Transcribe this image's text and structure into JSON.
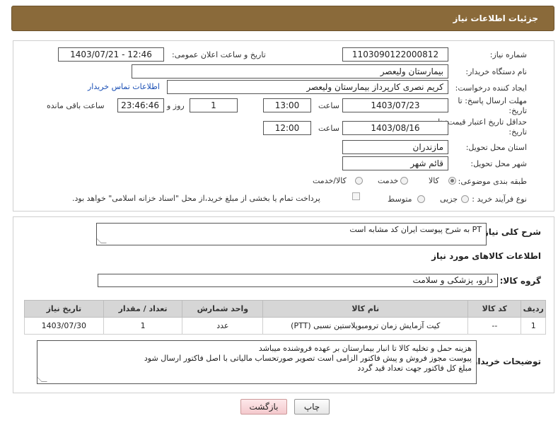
{
  "header": {
    "title": "جزئیات اطلاعات نیاز"
  },
  "form": {
    "need_number_label": "شماره نیاز:",
    "need_number": "1103090122000812",
    "announce_label": "تاریخ و ساعت اعلان عمومی:",
    "announce_value": "1403/07/21 - 12:46",
    "buyer_org_label": "نام دستگاه خریدار:",
    "buyer_org": "بیمارستان ولیعصر",
    "creator_label": "ایجاد کننده درخواست:",
    "creator": "کریم نصری کارپرداز بیمارستان ولیعصر",
    "contact_link": "اطلاعات تماس خریدار",
    "reply_deadline_label": "مهلت ارسال پاسخ: تا تاریخ:",
    "reply_date": "1403/07/23",
    "time_label": "ساعت",
    "reply_time": "13:00",
    "days_value": "1",
    "days_and_label": "روز و",
    "remaining_time": "23:46:46",
    "remaining_label": "ساعت باقی مانده",
    "price_validity_label": "حداقل تاریخ اعتبار قیمت: تا تاریخ:",
    "price_date": "1403/08/16",
    "price_time": "12:00",
    "province_label": "استان محل تحویل:",
    "province": "مازندران",
    "city_label": "شهر محل تحویل:",
    "city": "قائم شهر",
    "category_label": "طبقه بندی موضوعی:",
    "category_options": [
      "کالا",
      "خدمت",
      "کالا/خدمت"
    ],
    "purchase_type_label": "نوع فرآیند خرید :",
    "purchase_options": [
      "جزیی",
      "متوسط"
    ],
    "payment_note": "پرداخت تمام یا بخشی از مبلغ خرید،از محل \"اسناد خزانه اسلامی\" خواهد بود."
  },
  "description": {
    "label": "شرح کلی نیاز:",
    "text": "PT به شرح پیوست   ایران کد مشابه است"
  },
  "goods": {
    "section_title": "اطلاعات کالاهای مورد نیاز",
    "group_label": "گروه کالا:",
    "group_value": "دارو، پزشکی و سلامت",
    "columns": [
      "ردیف",
      "کد کالا",
      "نام کالا",
      "واحد شمارش",
      "تعداد / مقدار",
      "تاریخ نیاز"
    ],
    "rows": [
      [
        "1",
        "--",
        "کیت آزمایش زمان ترومبوپلاستین نسبی (PTT)",
        "عدد",
        "1",
        "1403/07/30"
      ]
    ]
  },
  "buyer_notes": {
    "label": "توضیحات خریدار:",
    "lines": [
      "هزینه حمل و تخلیه کالا تا انبار بیمارستان بر عهده فروشنده میباشد",
      "پیوست مجوز فروش و پیش فاکتور الزامی است  تصویر صورتحساب مالیاتی با اصل فاکتور ارسال شود",
      "مبلغ کل فاکتور جهت تعداد قید گردد"
    ]
  },
  "buttons": {
    "print": "چاپ",
    "back": "بازگشت"
  }
}
